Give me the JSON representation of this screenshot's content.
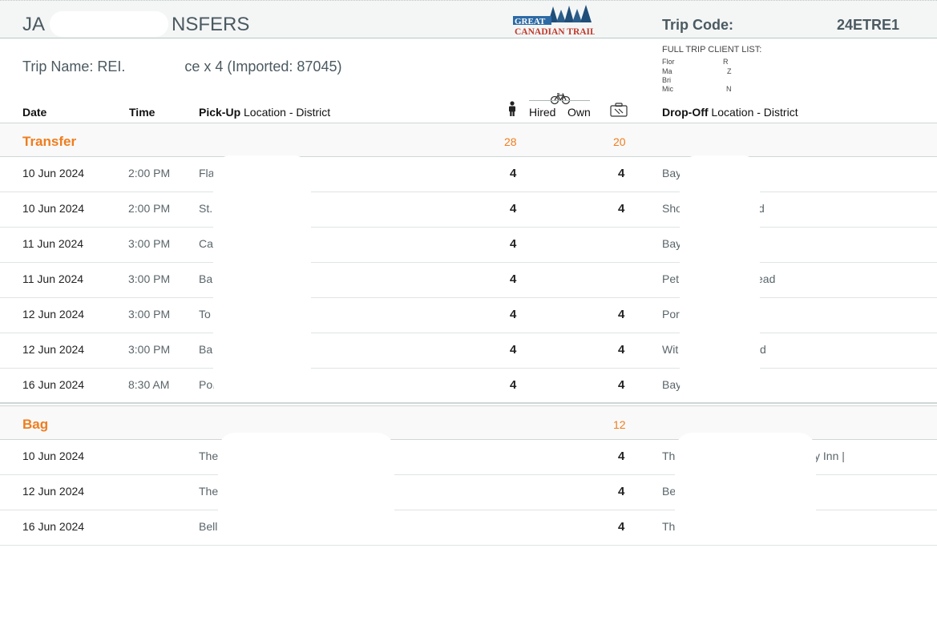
{
  "header": {
    "title": "JA▮▮▮▮▮▮▮NSFERS",
    "title_left": "JA",
    "title_right": "NSFERS",
    "trip_code_label": "Trip Code:",
    "trip_code_value": "24ETRE1",
    "logo_text_top": "GREAT",
    "logo_text_bottom": "CANADIAN TRAILS"
  },
  "trip": {
    "name_left": "Trip Name: REI.",
    "name_right": "ce x 4 (Imported: 87045)"
  },
  "client_list": {
    "title": "FULL TRIP CLIENT LIST:",
    "items": [
      {
        "a": "Flor",
        "b": "R"
      },
      {
        "a": "Ma",
        "b": "Z"
      },
      {
        "a": "Bri",
        "b": ""
      },
      {
        "a": "Mic",
        "b": "N"
      }
    ]
  },
  "columns": {
    "date": "Date",
    "time": "Time",
    "pickup_bold": "Pick-Up",
    "pickup_rest": " Location - District",
    "hired": "Hired",
    "own": "Own",
    "dropoff_bold": "Drop-Off",
    "dropoff_rest": " Location - District"
  },
  "sections": {
    "transfer": {
      "label": "Transfer",
      "people_total": "28",
      "bags_total": "20",
      "rows": [
        {
          "date": "10 Jun 2024",
          "time": "2:00 PM",
          "pickup": "Fla",
          "people": "4",
          "bags": "4",
          "dropoff": "Bay",
          "dropoff_tail": ""
        },
        {
          "date": "10 Jun 2024",
          "time": "2:00 PM",
          "pickup": "St.",
          "people": "4",
          "bags": "4",
          "dropoff": "Sho",
          "dropoff_tail": "d"
        },
        {
          "date": "11 Jun 2024",
          "time": "3:00 PM",
          "pickup": "Ca",
          "people": "4",
          "bags": "",
          "dropoff": "Bay",
          "dropoff_tail": ""
        },
        {
          "date": "11 Jun 2024",
          "time": "3:00 PM",
          "pickup": "Ba",
          "people": "4",
          "bags": "",
          "dropoff": "Pet",
          "dropoff_tail": "ead"
        },
        {
          "date": "12 Jun 2024",
          "time": "3:00 PM",
          "pickup": "To",
          "people": "4",
          "bags": "4",
          "dropoff": "Por",
          "dropoff_tail": ""
        },
        {
          "date": "12 Jun 2024",
          "time": "3:00 PM",
          "pickup": "Ba",
          "people": "4",
          "bags": "4",
          "dropoff": "Wit",
          "dropoff_tail": "d"
        },
        {
          "date": "16 Jun 2024",
          "time": "8:30 AM",
          "pickup": "Por.",
          "people": "4",
          "bags": "4",
          "dropoff": "Bay",
          "dropoff_tail": ""
        }
      ]
    },
    "bag": {
      "label": "Bag",
      "bags_total": "12",
      "rows": [
        {
          "date": "10 Jun 2024",
          "pickup": "The",
          "bags": "4",
          "dropoff": "Th",
          "dropoff_tail": "y Inn |"
        },
        {
          "date": "12 Jun 2024",
          "pickup": "The",
          "bags": "4",
          "dropoff": "Be",
          "dropoff_tail": ""
        },
        {
          "date": "16 Jun 2024",
          "pickup": "Bell",
          "bags": "4",
          "dropoff": "Th",
          "dropoff_tail": ""
        }
      ]
    }
  },
  "icons": {
    "person": "person-icon",
    "bike": "bicycle-icon",
    "bag": "luggage-icon"
  },
  "colors": {
    "accent_orange": "#ef7d1e",
    "header_text": "#4b5a61",
    "header_band": "#f4f6f6"
  }
}
